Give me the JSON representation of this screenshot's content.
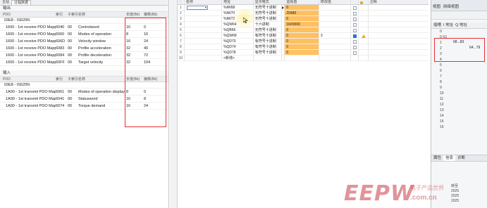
{
  "left_panel": {
    "tabs": [
      "主站",
      "过程数据"
    ],
    "output_section": "输出",
    "input_section": "输入",
    "columns": [
      "PDO",
      "索引",
      "子索引",
      "名称",
      "长度(Bit)",
      "偏移(Bit)"
    ],
    "output_device": "03E8 - IS620N",
    "output_rows": [
      {
        "pdo": "1600 - 1st receive PDO Mapping",
        "index": "6040",
        "sub": "00",
        "name": "Controlword",
        "len": "16",
        "off": "0"
      },
      {
        "pdo": "1600 - 1st receive PDO Mapping",
        "index": "6060",
        "sub": "00",
        "name": "Modes of operation",
        "len": "8",
        "off": "16"
      },
      {
        "pdo": "1600 - 1st receive PDO Mapping",
        "index": "606D",
        "sub": "00",
        "name": "Velocity window",
        "len": "16",
        "off": "24"
      },
      {
        "pdo": "1600 - 1st receive PDO Mapping",
        "index": "6083",
        "sub": "00",
        "name": "Profile acceleration",
        "len": "32",
        "off": "40"
      },
      {
        "pdo": "1600 - 1st receive PDO Mapping",
        "index": "6084",
        "sub": "00",
        "name": "Profile deceleration",
        "len": "32",
        "off": "72"
      },
      {
        "pdo": "1600 - 1st receive PDO Mapping",
        "index": "60FF",
        "sub": "00",
        "name": "Target velocity",
        "len": "32",
        "off": "104"
      }
    ],
    "input_device": "03E8 - IS620N",
    "input_rows": [
      {
        "pdo": "1A00 - 1st transmit PDO Mapping",
        "index": "6061",
        "sub": "00",
        "name": "Modes of operation display",
        "len": "8",
        "off": "0"
      },
      {
        "pdo": "1A00 - 1st transmit PDO Mapping",
        "index": "6041",
        "sub": "00",
        "name": "Statusword",
        "len": "16",
        "off": "8"
      },
      {
        "pdo": "1A00 - 1st transmit PDO Mapping",
        "index": "6074",
        "sub": "00",
        "name": "Torque demand",
        "len": "16",
        "off": "24"
      }
    ]
  },
  "monitor_table": {
    "columns": [
      "名称",
      "地址",
      "显示格式",
      "监视值",
      "修改值",
      "注释"
    ],
    "rows": [
      {
        "num": "1",
        "name": "",
        "addr": "%IW68",
        "fmt": "无符号十进制",
        "mon": "0",
        "mod": ""
      },
      {
        "num": "2",
        "name": "",
        "addr": "%IW70",
        "fmt": "无符号十进制",
        "mon": "20480",
        "mod": ""
      },
      {
        "num": "3",
        "name": "",
        "addr": "%IW72",
        "fmt": "无符号十进制",
        "mon": "0",
        "mod": ""
      },
      {
        "num": "4",
        "name": "",
        "addr": "%QW64",
        "fmt": "十六进制",
        "mon": "16#0000",
        "mod": ""
      },
      {
        "num": "5",
        "name": "",
        "addr": "%QB66",
        "fmt": "无符号十进制",
        "mon": "0",
        "mod": ""
      },
      {
        "num": "6",
        "name": "",
        "addr": "%QW68",
        "fmt": "有符号十进制",
        "mon": "0",
        "mod": "3"
      },
      {
        "num": "7",
        "name": "",
        "addr": "%QD70",
        "fmt": "有符号十进制",
        "mon": "0",
        "mod": ""
      },
      {
        "num": "8",
        "name": "",
        "addr": "%QD74",
        "fmt": "有符号十进制",
        "mon": "0",
        "mod": ""
      },
      {
        "num": "9",
        "name": "",
        "addr": "%QD78",
        "fmt": "有符号十进制",
        "mon": "0",
        "mod": ""
      },
      {
        "num": "10",
        "name": "",
        "addr": "<新增>",
        "fmt": "",
        "mon": "",
        "mod": ""
      }
    ]
  },
  "right_panel": {
    "toolbar": [
      "视图",
      "网络视图"
    ],
    "columns": [
      "插槽",
      "I 地址",
      "Q 地址"
    ],
    "slots": [
      "0",
      "0 X1",
      "1",
      "2",
      "3",
      "4",
      "5",
      "6",
      "7",
      "8",
      "9",
      "10",
      "11",
      "12",
      "13",
      "14",
      "15",
      "16"
    ],
    "i_address": "68...83",
    "q_address": "64...79",
    "bottom_tabs": [
      "属性",
      "信息",
      "诊断"
    ],
    "bottom_label": "转至",
    "bottom_values": [
      "2025",
      "2025",
      "2025"
    ]
  },
  "watermark": {
    "big": "EEPW",
    "small": "电子产品世界",
    "domain": ".com.cn"
  },
  "colors": {
    "highlight_red": "#e83030",
    "monitor_orange": "#ffc060"
  }
}
